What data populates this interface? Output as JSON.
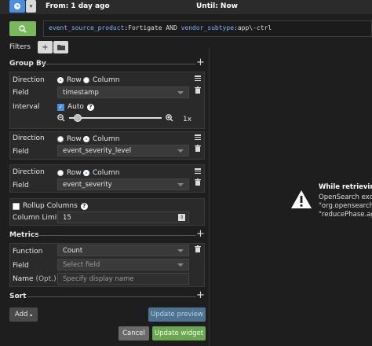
{
  "timebar": {
    "from": "From: 1 day ago",
    "until": "Until: Now"
  },
  "query": {
    "key1": "event_source_product",
    "val1": ":Fortigate AND ",
    "key2": "vendor_subtype",
    "val2": ":app\\-ctrl"
  },
  "filters": {
    "label": "Filters",
    "add_label": "+"
  },
  "group_by": {
    "title": "Group By",
    "rows": [
      {
        "direction_label": "Direction",
        "row_label": "Row",
        "column_label": "Column",
        "selected": "row",
        "field_label": "Field",
        "field_value": "timestamp",
        "interval_label": "Interval",
        "auto_label": "Auto",
        "scale_label": "1x"
      },
      {
        "direction_label": "Direction",
        "row_label": "Row",
        "column_label": "Column",
        "selected": "column",
        "field_label": "Field",
        "field_value": "event_severity_level"
      },
      {
        "direction_label": "Direction",
        "row_label": "Row",
        "column_label": "Column",
        "selected": "column",
        "field_label": "Field",
        "field_value": "event_severity"
      }
    ],
    "rollup_label": "Rollup Columns",
    "column_limit_label": "Column Limit",
    "column_limit_value": "15"
  },
  "metrics": {
    "title": "Metrics",
    "function_label": "Function",
    "function_value": "Count",
    "field_label": "Field",
    "field_placeholder": "Select field",
    "name_label": "Name",
    "name_opt": "(Opt.)",
    "name_placeholder": "Specify display name"
  },
  "sort": {
    "title": "Sort"
  },
  "buttons": {
    "add": "Add",
    "update_preview": "Update preview",
    "cancel": "Cancel",
    "update_widget": "Update widget"
  },
  "error": {
    "title": "While retrieving d",
    "line1": "OpenSearch excep",
    "line2": "\"org.opensearch.s",
    "line3": "\"reducePhase.agg"
  },
  "colors": {
    "accent_blue": "#4a90e2",
    "accent_green": "#7ab85c",
    "update_widget_green": "#6aa84f"
  }
}
